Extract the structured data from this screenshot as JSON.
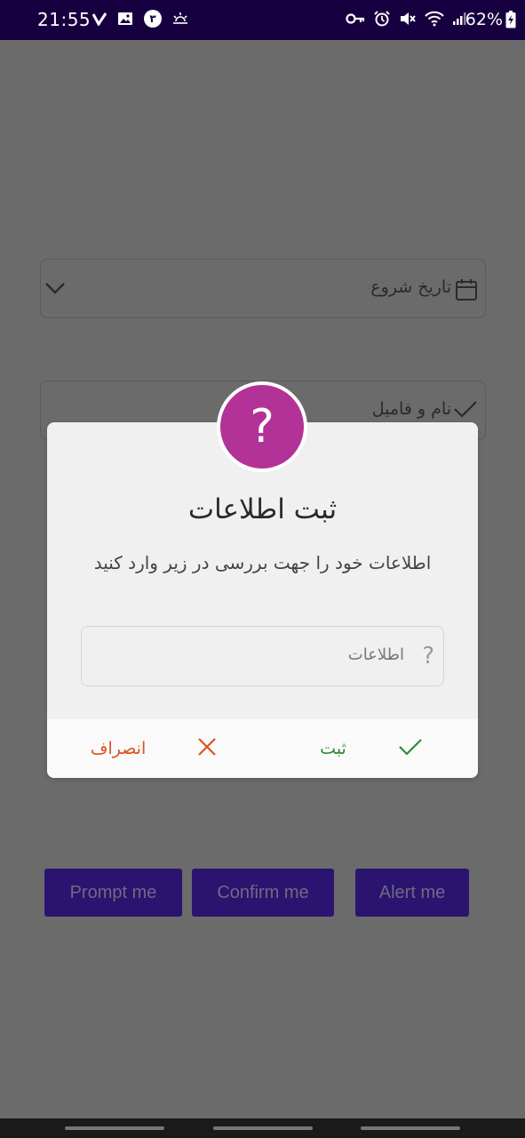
{
  "status_bar": {
    "time": "21:55",
    "notification_count": "٣",
    "battery": "62%"
  },
  "form": {
    "start_date_label": "تاریخ شروع",
    "name_label": "نام و فامیل"
  },
  "dialog": {
    "icon_glyph": "?",
    "title": "ثبت اطلاعات",
    "message": "اطلاعات خود را جهت بررسی در زیر وارد کنید",
    "input_placeholder": "اطلاعات",
    "submit_label": "ثبت",
    "cancel_label": "انصراف"
  },
  "buttons": {
    "prompt": "Prompt me",
    "confirm": "Confirm me",
    "alert": "Alert me"
  },
  "colors": {
    "status_bar": "#17003f",
    "dialog_badge": "#b33297",
    "submit": "#2e8b3a",
    "cancel": "#d9541e",
    "button_bg": "#2b1370"
  }
}
